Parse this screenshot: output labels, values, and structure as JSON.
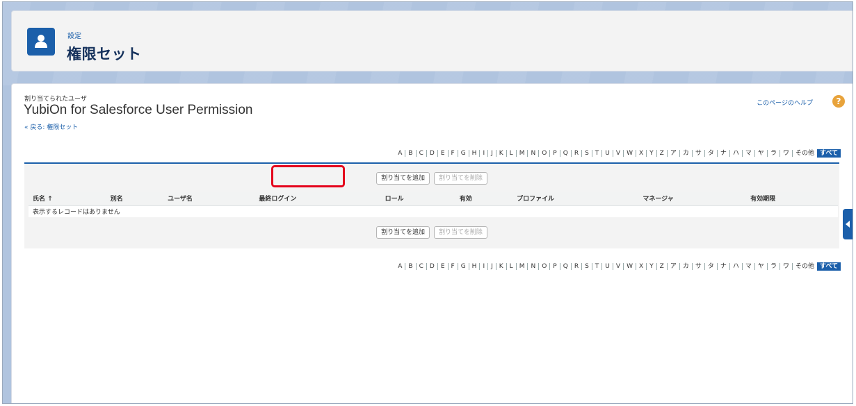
{
  "header": {
    "breadcrumb": "設定",
    "title": "権限セット"
  },
  "record": {
    "sub_label": "割り当てられたユーザ",
    "title": "YubiOn for Salesforce User Permission",
    "back_link": "« 戻る: 権限セット",
    "help_link": "このページのヘルプ",
    "help_icon": "?"
  },
  "alpha_filter": [
    "A",
    "B",
    "C",
    "D",
    "E",
    "F",
    "G",
    "H",
    "I",
    "J",
    "K",
    "L",
    "M",
    "N",
    "O",
    "P",
    "Q",
    "R",
    "S",
    "T",
    "U",
    "V",
    "W",
    "X",
    "Y",
    "Z",
    "ア",
    "カ",
    "サ",
    "タ",
    "ナ",
    "ハ",
    "マ",
    "ヤ",
    "ラ",
    "ワ",
    "その他",
    "すべて"
  ],
  "alpha_active": "すべて",
  "buttons": {
    "add": "割り当てを追加",
    "remove": "割り当てを削除"
  },
  "table": {
    "columns": [
      "氏名 ↑",
      "別名",
      "ユーザ名",
      "最終ログイン",
      "ロール",
      "有効",
      "プロファイル",
      "マネージャ",
      "有効期限"
    ],
    "empty_message": "表示するレコードはありません"
  },
  "colors": {
    "brand_blue": "#1b5faa",
    "highlight_red": "#e4001b"
  }
}
